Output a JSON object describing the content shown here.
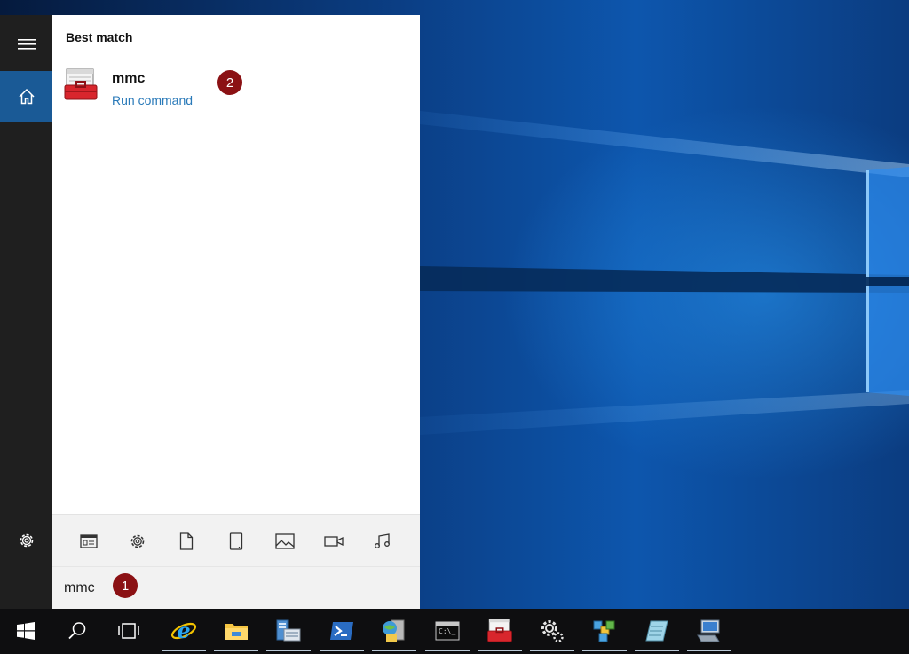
{
  "start_menu": {
    "best_match_heading": "Best match",
    "result": {
      "title": "mmc",
      "subtitle": "Run command",
      "icon": "mmc-toolbox-icon"
    },
    "rail": {
      "icons": [
        "hamburger-icon",
        "home-icon",
        "settings-gear-icon"
      ]
    },
    "filter_icons": [
      "apps-filter-icon",
      "settings-filter-icon",
      "documents-filter-icon",
      "tablet-filter-icon",
      "photos-filter-icon",
      "videos-filter-icon",
      "music-filter-icon"
    ],
    "search": {
      "value": "mmc"
    }
  },
  "annotations": {
    "step1": "1",
    "step2": "2"
  },
  "taskbar": {
    "items": [
      "windows-start-icon",
      "search-icon",
      "task-view-icon",
      "internet-explorer-icon",
      "file-explorer-icon",
      "server-manager-icon",
      "powershell-icon",
      "network-folder-icon",
      "command-prompt-icon",
      "mmc-toolbox-icon",
      "settings-gear-icon",
      "registry-icon",
      "notepad-icon",
      "remote-desktop-icon"
    ]
  },
  "colors": {
    "accent": "#1a5a96",
    "link": "#2a7ab9",
    "badge": "#8b1114",
    "rail": "#1f1f1f",
    "taskbar": "#0e0e10"
  }
}
